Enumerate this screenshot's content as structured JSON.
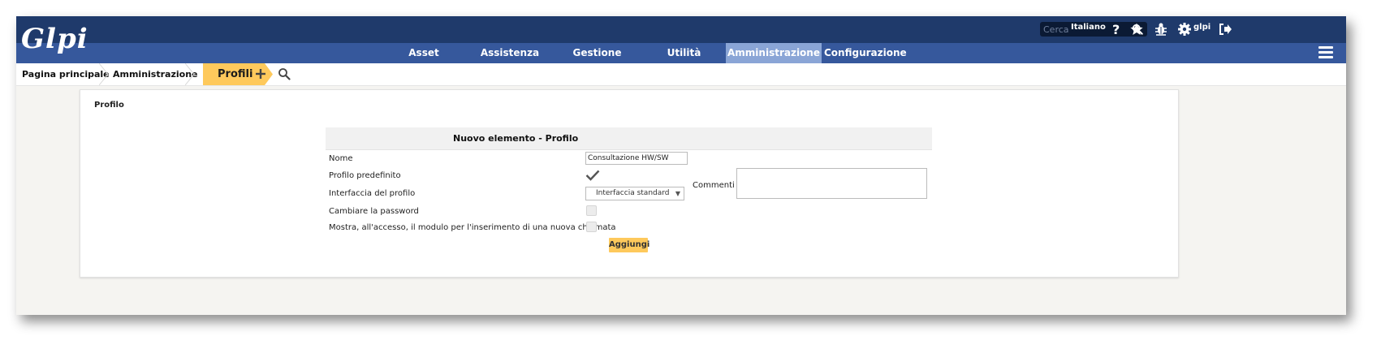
{
  "header": {
    "logo_text": "Glpi",
    "search_placeholder": "Cerca",
    "language": "Italiano",
    "user": "glpi"
  },
  "nav": {
    "items": [
      {
        "label": "Asset"
      },
      {
        "label": "Assistenza"
      },
      {
        "label": "Gestione"
      },
      {
        "label": "Utilità"
      },
      {
        "label": "Amministrazione",
        "active": true
      },
      {
        "label": "Configurazione"
      }
    ]
  },
  "breadcrumb": {
    "items": [
      {
        "label": "Pagina principale"
      },
      {
        "label": "Amministrazione"
      },
      {
        "label": "Profili",
        "active": true
      }
    ]
  },
  "panel": {
    "title": "Profilo"
  },
  "form": {
    "header": "Nuovo elemento - Profilo",
    "fields": {
      "name_label": "Nome",
      "name_value": "Consultazione HW/SW",
      "default_label": "Profilo predefinito",
      "default_checked": true,
      "interface_label": "Interfaccia del profilo",
      "interface_value": "Interfaccia standard",
      "password_label": "Cambiare la password",
      "password_checked": false,
      "ticket_label": "Mostra, all'accesso, il modulo per l'inserimento di una nuova chiamata",
      "ticket_checked": false,
      "comments_label": "Commenti",
      "comments_value": ""
    },
    "submit_label": "Aggiungi"
  },
  "colors": {
    "topbar": "#1f3a6b",
    "navbar": "#36589c",
    "nav_active": "#8aa5d6",
    "accent": "#fec95c"
  }
}
